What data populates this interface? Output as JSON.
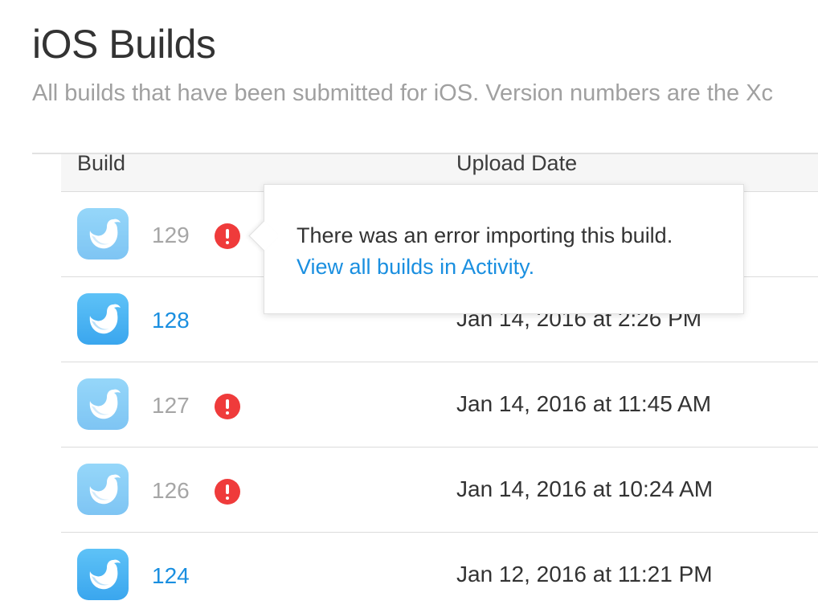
{
  "page": {
    "title": "iOS Builds",
    "subtitle": "All builds that have been submitted for iOS. Version numbers are the Xc"
  },
  "table": {
    "columns": [
      "Build",
      "Upload Date"
    ],
    "rows": [
      {
        "build": "129",
        "status": "error",
        "date": ""
      },
      {
        "build": "128",
        "status": "ok",
        "date": "Jan 14, 2016 at 2:26 PM"
      },
      {
        "build": "127",
        "status": "error",
        "date": "Jan 14, 2016 at 11:45 AM"
      },
      {
        "build": "126",
        "status": "error",
        "date": "Jan 14, 2016 at 10:24 AM"
      },
      {
        "build": "124",
        "status": "ok",
        "date": "Jan 12, 2016 at 11:21 PM"
      }
    ]
  },
  "popover": {
    "message": "There was an error importing this build.",
    "link": "View all builds in Activity."
  },
  "colors": {
    "link": "#1a8fe0",
    "error": "#ef3b3b",
    "icon_top": "#5ec2f7",
    "icon_bottom": "#3aa6ee"
  },
  "icons": {
    "app": "bird-app-icon",
    "error": "exclamation-circle-icon"
  }
}
